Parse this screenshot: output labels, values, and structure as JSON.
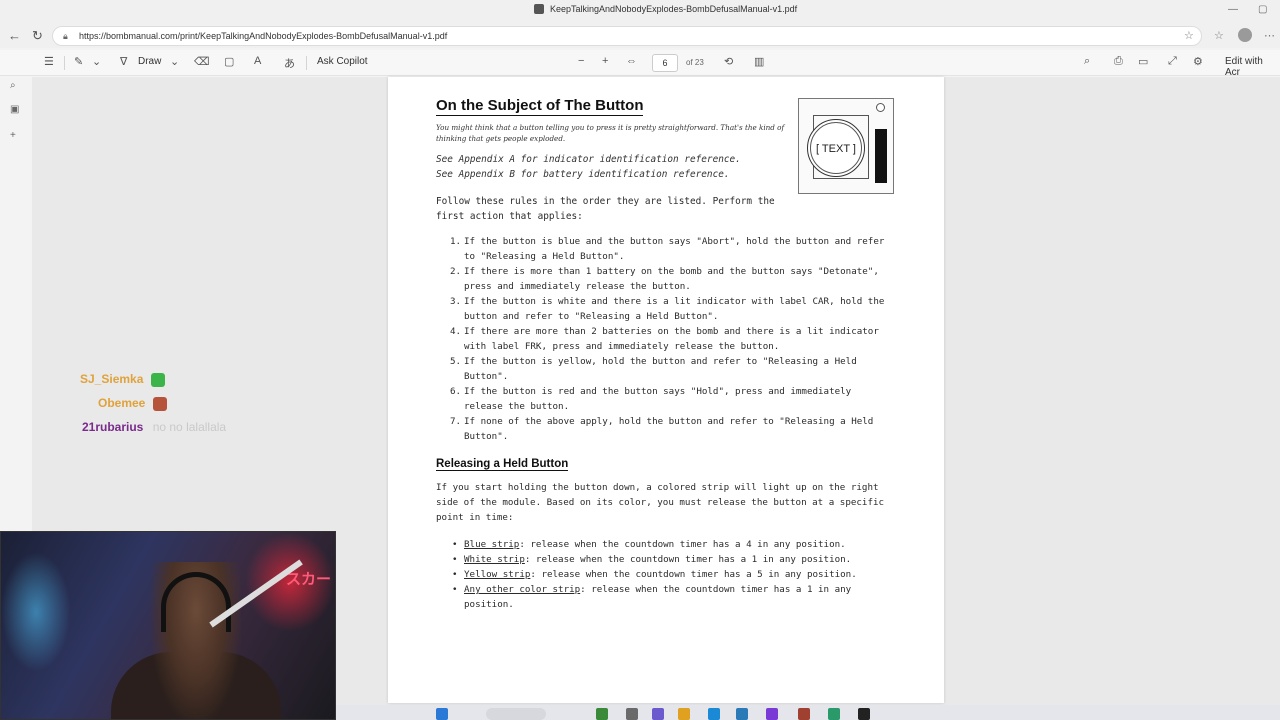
{
  "window": {
    "title": "KeepTalkingAndNobodyExplodes-BombDefusalManual-v1.pdf",
    "minimize": "—",
    "maximize": "▢"
  },
  "browser": {
    "url": "https://bombmanual.com/print/KeepTalkingAndNobodyExplodes-BombDefusalManual-v1.pdf"
  },
  "pdf_toolbar": {
    "draw_label": "Draw",
    "ask_copilot_label": "Ask Copilot",
    "page_current": "6",
    "page_total": "of 23",
    "edit_label": "Edit with Acr"
  },
  "page": {
    "heading": "On the Subject of The Button",
    "intro": "You might think that a button telling you to press it is pretty straightforward. That's the kind of thinking that gets people exploded.",
    "appendix_a": "See Appendix A for indicator identification reference.",
    "appendix_b": "See Appendix B for battery identification reference.",
    "follow": "Follow these rules in the order they are listed. Perform the first action that applies:",
    "module_text": "[ TEXT ]",
    "rules": [
      {
        "num": "1.",
        "text": "If the button is blue and the button says \"Abort\", hold the button and refer to \"Releasing a Held Button\"."
      },
      {
        "num": "2.",
        "text": "If there is more than 1 battery on the bomb and the button says \"Detonate\", press and immediately release the button."
      },
      {
        "num": "3.",
        "text": "If the button is white and there is a lit indicator with label CAR, hold the button and refer to \"Releasing a Held Button\"."
      },
      {
        "num": "4.",
        "text": "If there are more than 2 batteries on the bomb and there is a lit indicator with label FRK, press and immediately release the button."
      },
      {
        "num": "5.",
        "text": "If the button is yellow, hold the button and refer to \"Releasing a Held Button\"."
      },
      {
        "num": "6.",
        "text": "If the button is red and the button says \"Hold\", press and immediately release the button."
      },
      {
        "num": "7.",
        "text": "If none of the above apply, hold the button and refer to \"Releasing a Held Button\"."
      }
    ],
    "subheading": "Releasing a Held Button",
    "release_para": "If you start holding the button down, a colored strip will light up on the right side of the module. Based on its color, you must release the button at a specific point in time:",
    "strips": [
      {
        "label": "Blue strip",
        "text": ": release when the countdown timer has a 4 in any position."
      },
      {
        "label": "White strip",
        "text": ": release when the countdown timer has a 1 in any position."
      },
      {
        "label": "Yellow strip",
        "text": ": release when the countdown timer has a 5 in any position."
      },
      {
        "label": "Any other color strip",
        "text": ": release when the countdown timer has a 1 in any position."
      }
    ]
  },
  "chat": [
    {
      "user": "SJ_Siemka",
      "color": "#e0a23a",
      "badge_color": "#3bb54a",
      "message": ""
    },
    {
      "user": "Obemee",
      "color": "#e0a23a",
      "badge_color": "#b5533b",
      "message": ""
    },
    {
      "user": "21rubarius",
      "color": "#7a2a8a",
      "badge_color": "",
      "message": "no no lalallala"
    }
  ],
  "webcam": {
    "overlay_text": "スカー"
  },
  "colors": {
    "accent": "#0067c0",
    "page_bg": "#ffffff",
    "viewer_bg": "#e9e9e9"
  }
}
